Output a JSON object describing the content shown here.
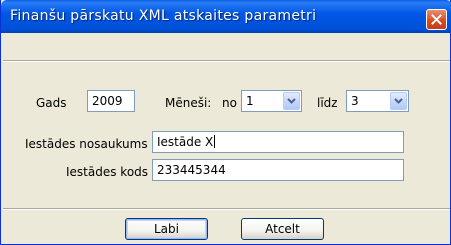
{
  "window": {
    "title": "Finanšu pārskatu XML atskaites parametri",
    "close_icon": "close-icon"
  },
  "form": {
    "year_label": "Gads",
    "year_value": "2009",
    "months_label": "Mēneši:",
    "from_label": "no",
    "from_value": "1",
    "to_label": "līdz",
    "to_value": "3",
    "institution_name_label": "Iestādes nosaukums",
    "institution_name_value": "Iestāde X",
    "institution_code_label": "Iestādes kods",
    "institution_code_value": "233445344"
  },
  "buttons": {
    "ok_label": "Labi",
    "cancel_label": "Atcelt"
  },
  "colors": {
    "titlebar": "#0058e6",
    "close_button": "#d5491f",
    "dialog_background": "#ece9d8",
    "field_border": "#7f9db9"
  }
}
